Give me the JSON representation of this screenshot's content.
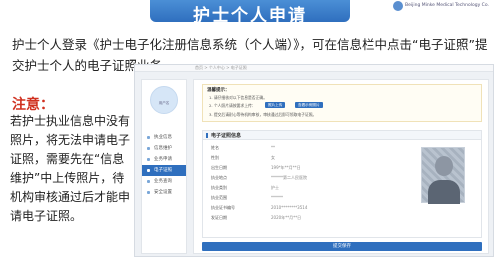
{
  "banner": {
    "title": "护士个人申请"
  },
  "logo": {
    "text": "Beijing Minke Medical Technology Co."
  },
  "intro": "护士个人登录《护士电子化注册信息系统（个人端）》，可在信息栏中点击“电子证照”提交护士个人的电子证照业务。",
  "note": {
    "title": "注意：",
    "text": "若护士执业信息中没有照片，将无法申请电子证照，需要先在“信息维护”中上传照片，待机构审核通过后才能申请电子证照。"
  },
  "screenshot": {
    "topbar": "首页 > 个人中心 > 电子证照",
    "avatar_name": "用户名",
    "menu": [
      {
        "label": "执业信息",
        "active": false
      },
      {
        "label": "信息维护",
        "active": false
      },
      {
        "label": "业务申请",
        "active": false
      },
      {
        "label": "电子证照",
        "active": true
      },
      {
        "label": "业务查询",
        "active": false
      },
      {
        "label": "安全设置",
        "active": false
      }
    ],
    "tips": {
      "title": "温馨提示：",
      "line1": "1. 请仔细核对以下信息是否正确。",
      "line2": "2. 个人照片请按要求上传：",
      "btn1": "照片上传",
      "btn2": "查看示例照片",
      "line3": "3. 提交后请耐心等待机构审核，审核通过后即可领取电子证照。"
    },
    "cert": {
      "title": "电子证照信息",
      "rows": [
        {
          "label": "姓名",
          "value": "**"
        },
        {
          "label": "性别",
          "value": "女"
        },
        {
          "label": "出生日期",
          "value": "199*年**月**日"
        },
        {
          "label": "执业地点",
          "value": "******第二人民医院"
        },
        {
          "label": "执业类别",
          "value": "护士"
        },
        {
          "label": "执业范围",
          "value": "******"
        },
        {
          "label": "执业证书编号",
          "value": "2010********3514"
        },
        {
          "label": "发证日期",
          "value": "2020年**月**日"
        }
      ]
    },
    "submit_label": "提交保存"
  }
}
